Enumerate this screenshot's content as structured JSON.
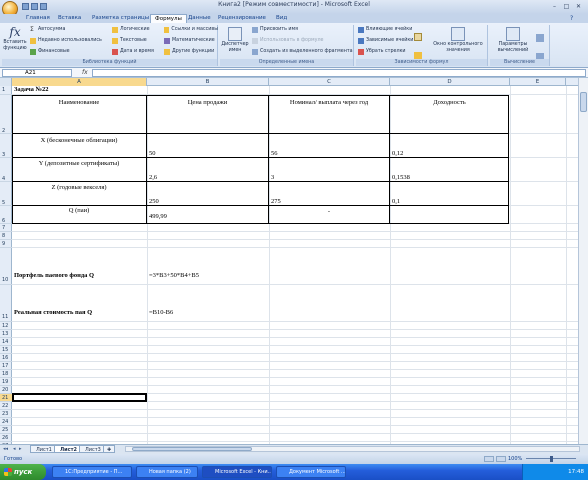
{
  "window": {
    "title": "Книга2  [Режим совместимости] - Microsoft Excel"
  },
  "ribbon_tabs": [
    "Главная",
    "Вставка",
    "Разметка страницы",
    "Формулы",
    "Данные",
    "Рецензирование",
    "Вид"
  ],
  "active_tab": "Формулы",
  "ribbon": {
    "insert_function": "Вставить функцию",
    "lib": {
      "autosum": "Автосумма",
      "recent": "Недавно использовались",
      "financial": "Финансовые",
      "logical": "Логические",
      "text": "Текстовые",
      "datetime": "Дата и время",
      "lookup": "Ссылки и массивы",
      "math": "Математические",
      "more": "Другие функции",
      "label": "Библиотека функций"
    },
    "names": {
      "manager": "Диспетчер имен",
      "define": "Присвоить имя",
      "use": "Использовать в формуле",
      "create": "Создать из выделенного фрагмента",
      "label": "Определенные имена"
    },
    "audit": {
      "precedents": "Влияющие ячейки",
      "dependents": "Зависимые ячейки",
      "remove": "Убрать стрелки",
      "watch": "Окно контрольного значения",
      "label": "Зависимости формул"
    },
    "calc": {
      "options": "Параметры вычислений",
      "label": "Вычисление"
    }
  },
  "formula_bar": {
    "name_box": "A21",
    "fx": "fx",
    "value": ""
  },
  "columns": [
    "A",
    "B",
    "C",
    "D",
    "E"
  ],
  "rows": [
    "1",
    "2",
    "3",
    "4",
    "5",
    "6",
    "7",
    "8",
    "9",
    "10",
    "11",
    "12",
    "13",
    "14",
    "15",
    "16",
    "17",
    "18",
    "19",
    "20",
    "21",
    "22",
    "23",
    "24",
    "25",
    "26",
    "27"
  ],
  "cells": {
    "a1": "Задача №22",
    "a2": "Наименование",
    "b2": "Цена продажи",
    "c2": "Номинал/ выплата через год",
    "d2": "Доходность",
    "a3": "X (бесконечные облигации)",
    "b3": "50",
    "c3": "56",
    "d3": "0,12",
    "a4": "Y (депозитные сертификаты)",
    "b4": "2,6",
    "c4": "3",
    "d4": "0,1538",
    "a5": "Z (годовые векселя)",
    "b5": "250",
    "c5": "275",
    "d5": "0,1",
    "a6": "Q (паи)",
    "b6": "499,99",
    "c6": "-",
    "a10": "Портфель паевого фонда Q",
    "b10": "=3*B3+50*B4+B5",
    "a11": "Реальная стоимость пая Q",
    "b11": "=B10-B6"
  },
  "sheets": [
    "Лист1",
    "Лист2",
    "Лист3"
  ],
  "active_sheet": "Лист2",
  "status": {
    "left": "Готово",
    "zoom": "100%"
  },
  "taskbar": {
    "start": "пуск",
    "items": [
      "1С:Предприятие - П...",
      "Новая папка (2)",
      "Microsoft Excel - Кни...",
      "Документ Microsoft ..."
    ],
    "clock": "17:48"
  }
}
